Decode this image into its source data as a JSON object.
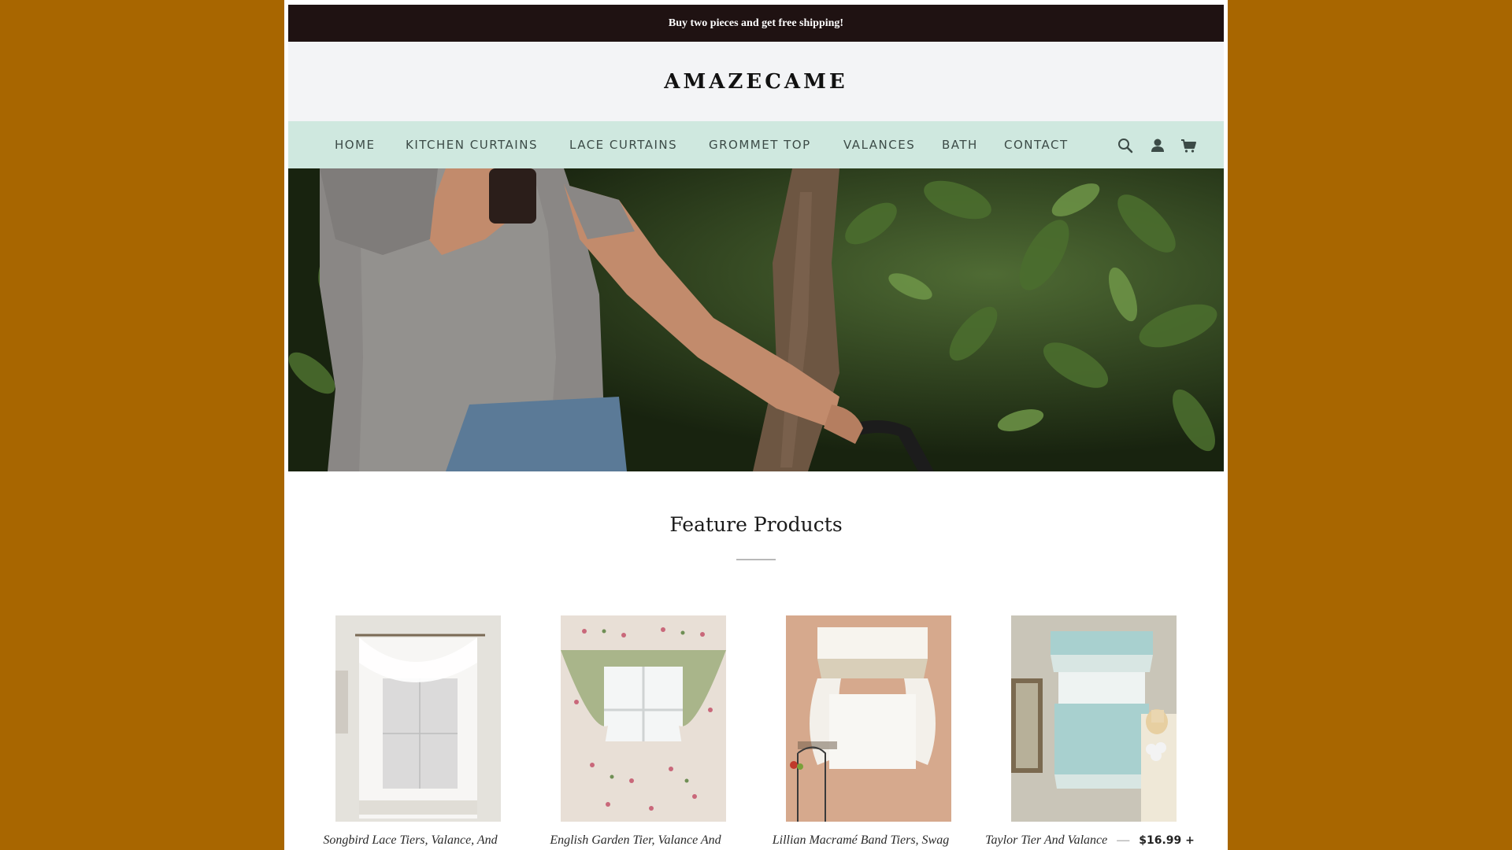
{
  "announcement": {
    "text": "Buy two pieces and get free shipping!"
  },
  "header": {
    "logo": "AMAZECAME"
  },
  "nav": {
    "items": [
      {
        "label": "HOME"
      },
      {
        "label": "KITCHEN CURTAINS"
      },
      {
        "label": "LACE CURTAINS"
      },
      {
        "label": "GROMMET TOP"
      },
      {
        "label": "VALANCES"
      },
      {
        "label": "BATH"
      },
      {
        "label": "CONTACT"
      }
    ],
    "icons": [
      "search-icon",
      "account-icon",
      "cart-icon"
    ]
  },
  "featured": {
    "title": "Feature Products",
    "products": [
      {
        "name": "Songbird Lace Tiers, Valance, And"
      },
      {
        "name": "English Garden Tier, Valance And"
      },
      {
        "name": "Lillian Macramé Band Tiers, Swag"
      },
      {
        "name": "Taylor Tier And Valance",
        "separator": "—",
        "price": "$16.99 +"
      }
    ]
  },
  "colors": {
    "background": "#a86600",
    "announcement_bg": "#1f1212",
    "header_bg": "#f3f4f6",
    "nav_bg": "#cfe8df"
  }
}
